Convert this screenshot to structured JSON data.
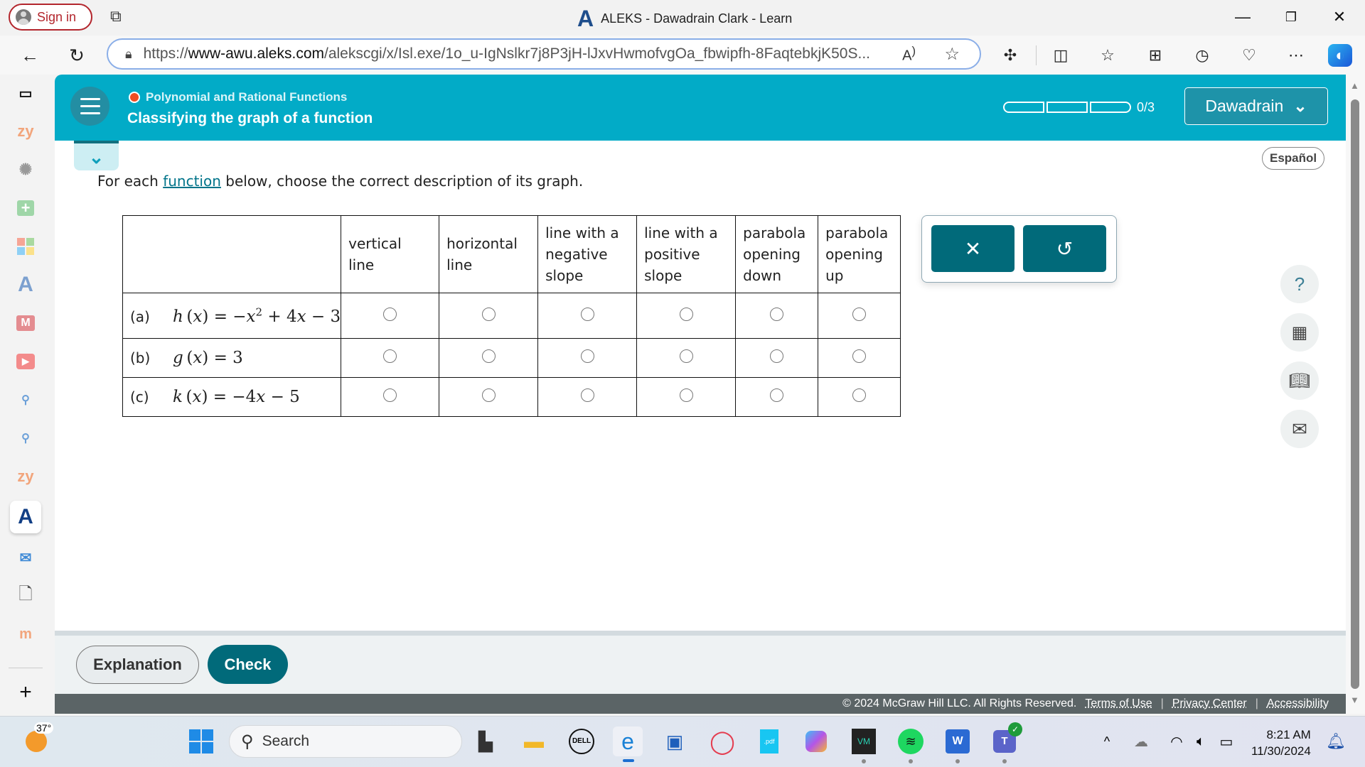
{
  "browser": {
    "sign_in": "Sign in",
    "window_title": "ALEKS - Dawadrain Clark - Learn",
    "title_logo": "A",
    "url_prefix": "https://",
    "url_host": "www-awu.aleks.com",
    "url_path": "/alekscgi/x/Isl.exe/1o_u-IgNslkr7j8P3jH-lJxvHwmofvgOa_fbwipfh-8FaqtebkjK50S...",
    "read_aloud": "A)",
    "icons": [
      "back-icon",
      "refresh-icon",
      "lock-icon",
      "read-aloud-icon",
      "favorite-star-icon",
      "extensions-icon",
      "split-screen-icon",
      "favorites-icon",
      "collections-icon",
      "history-icon",
      "browser-essentials-icon",
      "more-icon",
      "copilot-icon"
    ]
  },
  "sidebar": {
    "items": [
      "tab-actions",
      "zybooks",
      "chatgpt",
      "add-tab",
      "microsoft",
      "aleks",
      "gmail",
      "youtube",
      "search",
      "search",
      "zybooks",
      "aleks-active",
      "outlook",
      "document",
      "moodle",
      "add"
    ]
  },
  "header": {
    "topic": "Polynomial and Rational Functions",
    "lesson": "Classifying the graph of a function",
    "progress": {
      "completed": 0,
      "total": 3,
      "label": "0/3"
    },
    "user_name": "Dawadrain",
    "topic_dot_color": "#f04e23",
    "brand_color": "#02abc7"
  },
  "main": {
    "espanol": "Español",
    "instruction_before": "For each ",
    "instruction_link": "function",
    "instruction_after": " below, choose the correct description of its graph.",
    "columns": [
      "vertical line",
      "horizontal line",
      "line with a negative slope",
      "line with a positive slope",
      "parabola opening down",
      "parabola opening up"
    ],
    "rows": [
      {
        "label": "(a)",
        "fname": "h",
        "var": "x",
        "rhs_1": "= −",
        "rhs_var": "x",
        "rhs_sup": "2",
        "rhs_2": " + 4",
        "rhs_var2": "x",
        "rhs_3": " − 3",
        "selected": null
      },
      {
        "label": "(b)",
        "fname": "g",
        "var": "x",
        "rhs": "= 3",
        "selected": null
      },
      {
        "label": "(c)",
        "fname": "k",
        "var": "x",
        "rhs_1": "= −4",
        "rhs_var": "x",
        "rhs_2": " − 5",
        "selected": null
      }
    ],
    "tools": {
      "clear": "✕",
      "undo": "↺"
    },
    "side_tools": [
      "help",
      "calculator-disabled",
      "ebook",
      "message"
    ],
    "help_glyph": "?"
  },
  "bottom": {
    "explanation": "Explanation",
    "check": "Check",
    "accent": "#016a7a"
  },
  "footer": {
    "copyright": "© 2024 McGraw Hill LLC. All Rights Reserved.",
    "terms": "Terms of Use",
    "privacy": "Privacy Center",
    "accessibility": "Accessibility"
  },
  "taskbar": {
    "weather": "37°",
    "search": "Search",
    "time": "8:21 AM",
    "date": "11/30/2024"
  }
}
